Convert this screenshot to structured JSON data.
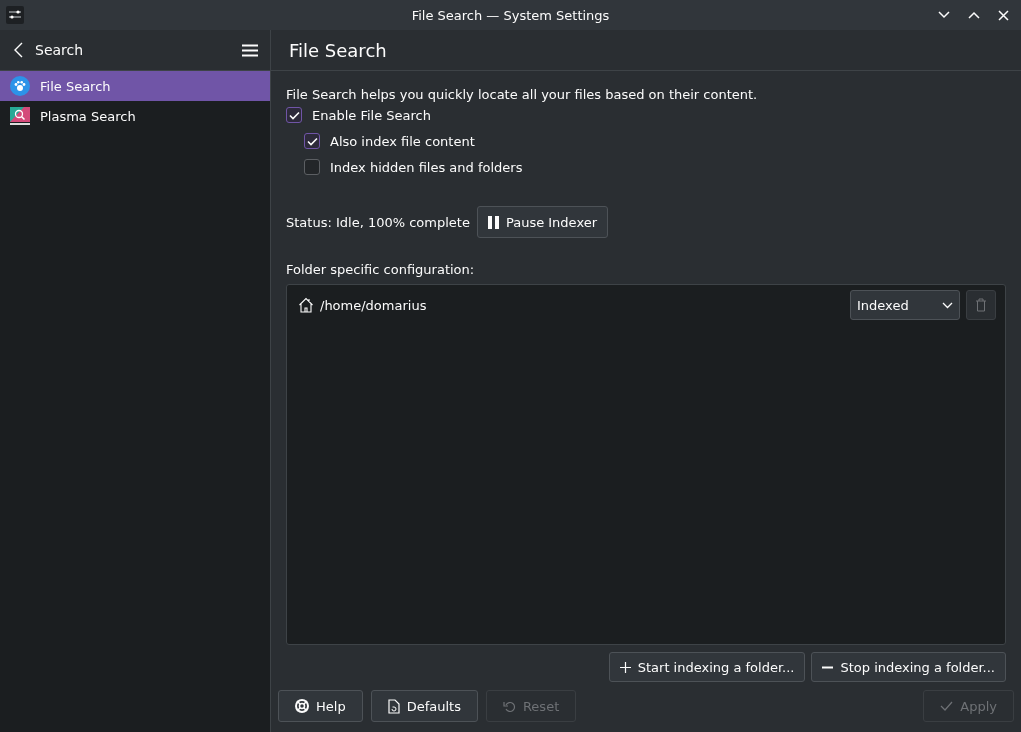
{
  "window": {
    "title": "File Search — System Settings"
  },
  "sidebar": {
    "title": "Search",
    "items": [
      {
        "label": "File Search",
        "selected": true
      },
      {
        "label": "Plasma Search",
        "selected": false
      }
    ]
  },
  "page": {
    "title": "File Search",
    "description": "File Search helps you quickly locate all your files based on their content.",
    "options": [
      {
        "label": "Enable File Search",
        "checked": true,
        "children": [
          {
            "label": "Also index file content",
            "checked": true
          },
          {
            "label": "Index hidden files and folders",
            "checked": false
          }
        ]
      }
    ],
    "status": "Status: Idle, 100% complete",
    "pause_button": "Pause Indexer",
    "folders_label": "Folder specific configuration:",
    "folders": [
      {
        "path": "/home/domarius",
        "mode": "Indexed",
        "remove_disabled": true
      }
    ],
    "folder_buttons": [
      "Start indexing a folder...",
      "Stop indexing a folder..."
    ]
  },
  "footer": [
    {
      "label": "Help",
      "disabled": false
    },
    {
      "label": "Defaults",
      "disabled": false
    },
    {
      "label": "Reset",
      "disabled": true
    },
    {
      "label": "Apply",
      "disabled": true
    }
  ]
}
